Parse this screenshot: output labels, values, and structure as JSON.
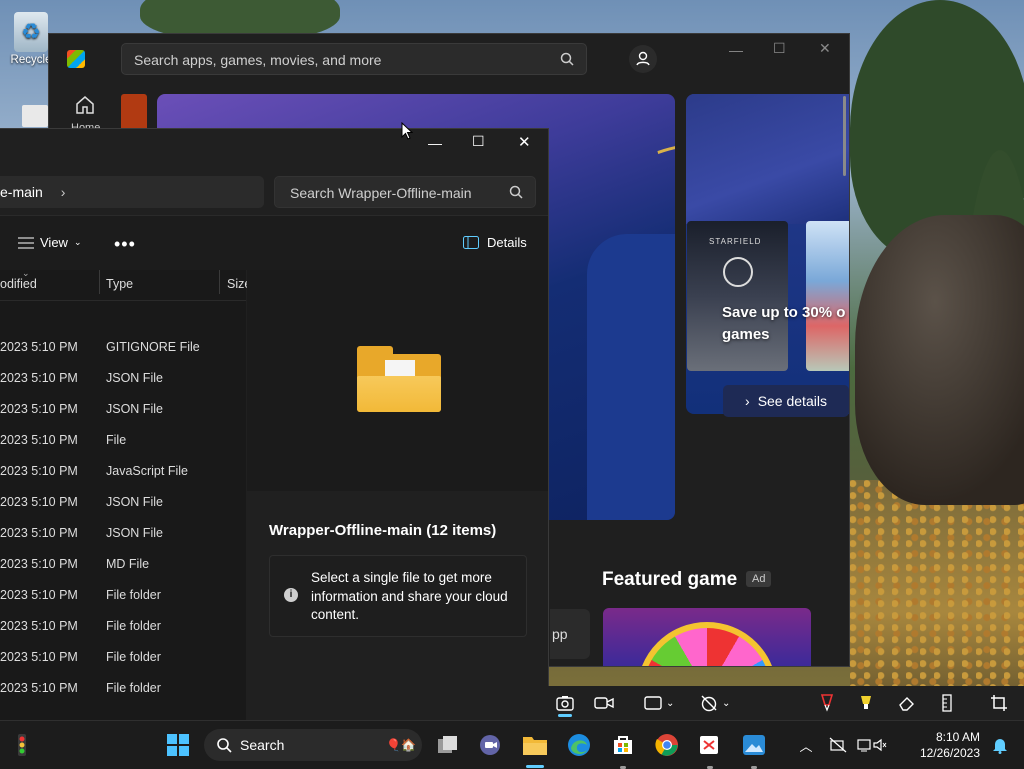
{
  "desktop": {
    "recycle_label": "Recycle"
  },
  "store": {
    "search_placeholder": "Search apps, games, movies, and more",
    "home_label": "Home",
    "sale_text": "Save up to 30% o games",
    "see_details": "See details",
    "starfield_thumb": "STARFIELD",
    "featured_title": "Featured game",
    "ad_badge": "Ad",
    "app_chip": "pp"
  },
  "explorer": {
    "breadcrumb": "e-main",
    "search_placeholder": "Search Wrapper-Offline-main",
    "toolbar": {
      "view_label": "View",
      "more_label": "•••",
      "details_label": "Details"
    },
    "columns": {
      "modified": "odified",
      "type": "Type",
      "size": "Size"
    },
    "rows": [
      {
        "date": "2023 5:10 PM",
        "type": "GITIGNORE File"
      },
      {
        "date": "2023 5:10 PM",
        "type": "JSON File"
      },
      {
        "date": "2023 5:10 PM",
        "type": "JSON File"
      },
      {
        "date": "2023 5:10 PM",
        "type": "File"
      },
      {
        "date": "2023 5:10 PM",
        "type": "JavaScript File"
      },
      {
        "date": "2023 5:10 PM",
        "type": "JSON File"
      },
      {
        "date": "2023 5:10 PM",
        "type": "JSON File"
      },
      {
        "date": "2023 5:10 PM",
        "type": "MD File"
      },
      {
        "date": "2023 5:10 PM",
        "type": "File folder"
      },
      {
        "date": "2023 5:10 PM",
        "type": "File folder"
      },
      {
        "date": "2023 5:10 PM",
        "type": "File folder"
      },
      {
        "date": "2023 5:10 PM",
        "type": "File folder"
      }
    ],
    "details": {
      "title": "Wrapper-Offline-main (12 items)",
      "message": "Select a single file to get more information and share your cloud content."
    }
  },
  "taskbar": {
    "search_label": "Search",
    "time": "8:10 AM",
    "date": "12/26/2023"
  },
  "colors": {
    "accent": "#60cdff",
    "folder_yellow": "#f2b938"
  }
}
